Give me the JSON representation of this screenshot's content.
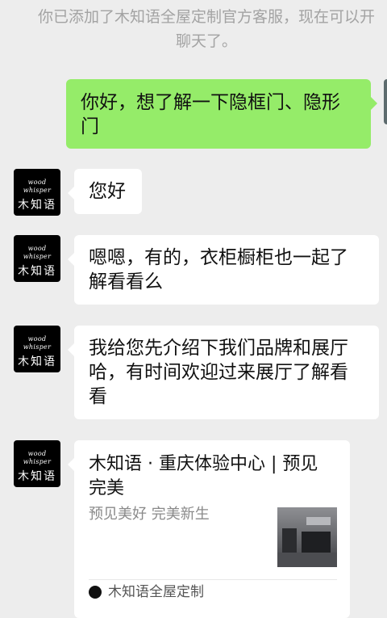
{
  "system_notice": {
    "line1": "你已添加了木知语全屋定制官方客服，现在可以开",
    "line2": "聊天了。"
  },
  "messages": {
    "outgoing": {
      "text": "你好，想了解一下隐框门、隐形门"
    },
    "incoming": [
      {
        "text": "您好"
      },
      {
        "text": "嗯嗯，有的，衣柜橱柜也一起了解看看么"
      },
      {
        "text": "我给您先介绍下我们品牌和展厅哈，有时间欢迎过来展厅了解看看"
      }
    ]
  },
  "avatar": {
    "english": "wood whisper",
    "chinese": "木知语"
  },
  "link_card": {
    "title": "木知语 · 重庆体验中心 | 预见 完美",
    "description": "预见美好 完美新生",
    "source": "木知语全屋定制"
  }
}
